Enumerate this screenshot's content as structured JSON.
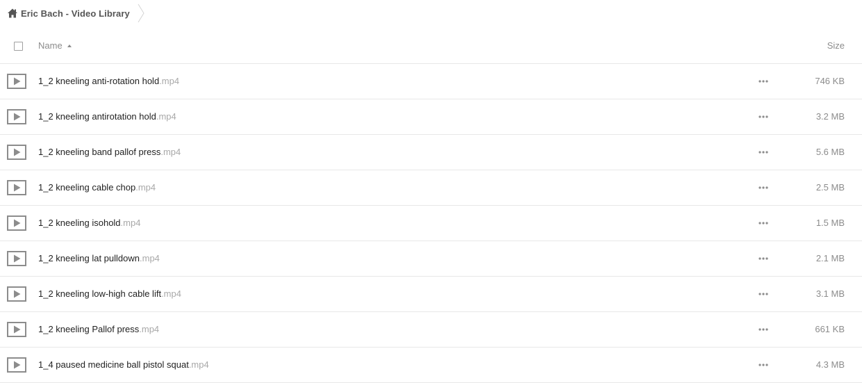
{
  "breadcrumb": {
    "title": "Eric Bach - Video Library"
  },
  "table": {
    "columns": {
      "name": "Name",
      "size": "Size"
    },
    "sort": "name-ascending"
  },
  "files": [
    {
      "base": "1_2 kneeling anti-rotation hold",
      "ext": ".mp4",
      "size": "746 KB"
    },
    {
      "base": "1_2 kneeling antirotation hold",
      "ext": ".mp4",
      "size": "3.2 MB"
    },
    {
      "base": "1_2 kneeling band pallof press",
      "ext": ".mp4",
      "size": "5.6 MB"
    },
    {
      "base": "1_2 kneeling cable chop",
      "ext": ".mp4",
      "size": "2.5 MB"
    },
    {
      "base": "1_2 kneeling isohold",
      "ext": ".mp4",
      "size": "1.5 MB"
    },
    {
      "base": "1_2 kneeling lat pulldown",
      "ext": ".mp4",
      "size": "2.1 MB"
    },
    {
      "base": "1_2 kneeling low-high cable lift",
      "ext": ".mp4",
      "size": "3.1 MB"
    },
    {
      "base": "1_2 kneeling Pallof press",
      "ext": ".mp4",
      "size": "661 KB"
    },
    {
      "base": "1_4 paused medicine ball pistol squat",
      "ext": ".mp4",
      "size": "4.3 MB"
    }
  ],
  "icons": {
    "home": "home-icon",
    "file": "video-file-icon",
    "more": "more-icon",
    "sort": "sort-ascending-icon"
  },
  "colors": {
    "text": "#222222",
    "muted": "#8c8c8c",
    "extension": "#a8a8a8",
    "divider": "#e8e8e8",
    "icon": "#8c8c8c"
  }
}
